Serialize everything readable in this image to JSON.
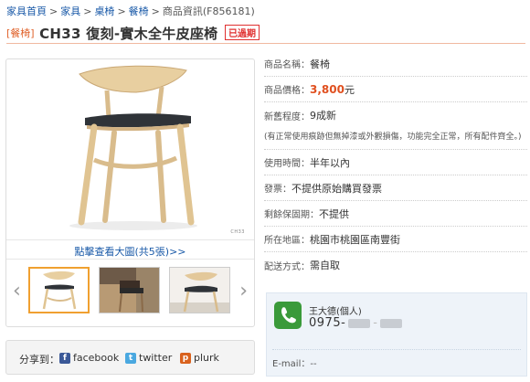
{
  "breadcrumb": {
    "items": [
      "家具首頁",
      "家具",
      "桌椅",
      "餐椅",
      "商品資訊(F856181)"
    ],
    "separator": ">"
  },
  "header": {
    "category": "[餐椅]",
    "title": "CH33 復刻-實木全牛皮座椅",
    "badge": "已過期"
  },
  "gallery": {
    "image_code": "CH33",
    "view_link": "點擊查看大圖(共5張)>>",
    "prev": "‹",
    "next": "›"
  },
  "share": {
    "label": "分享到：",
    "facebook": "facebook",
    "twitter": "twitter",
    "plurk": "plurk"
  },
  "details": {
    "name_label": "商品名稱：",
    "name_value": "餐椅",
    "price_label": "商品價格：",
    "price_value": "3,800",
    "price_unit": "元",
    "condition_label": "新舊程度：",
    "condition_value": "9成新",
    "condition_note": "(有正常使用痕跡但無掉漆或外觀損傷，功能完全正常，所有配件齊全。)",
    "usage_label": "使用時間：",
    "usage_value": "半年以內",
    "invoice_label": "發票：",
    "invoice_value": "不提供原始購買發票",
    "warranty_label": "剩餘保固期：",
    "warranty_value": "不提供",
    "location_label": "所在地區：",
    "location_value": "桃園市桃園區南豐街",
    "delivery_label": "配送方式：",
    "delivery_value": "需自取"
  },
  "contact": {
    "name": "王大德(個人)",
    "phone_prefix": "0975-",
    "email_label": "E-mail：",
    "email_value": "--"
  },
  "colors": {
    "link": "#1a5aa8",
    "price": "#e05020",
    "badge": "#e03030",
    "accent": "#e0622a"
  }
}
